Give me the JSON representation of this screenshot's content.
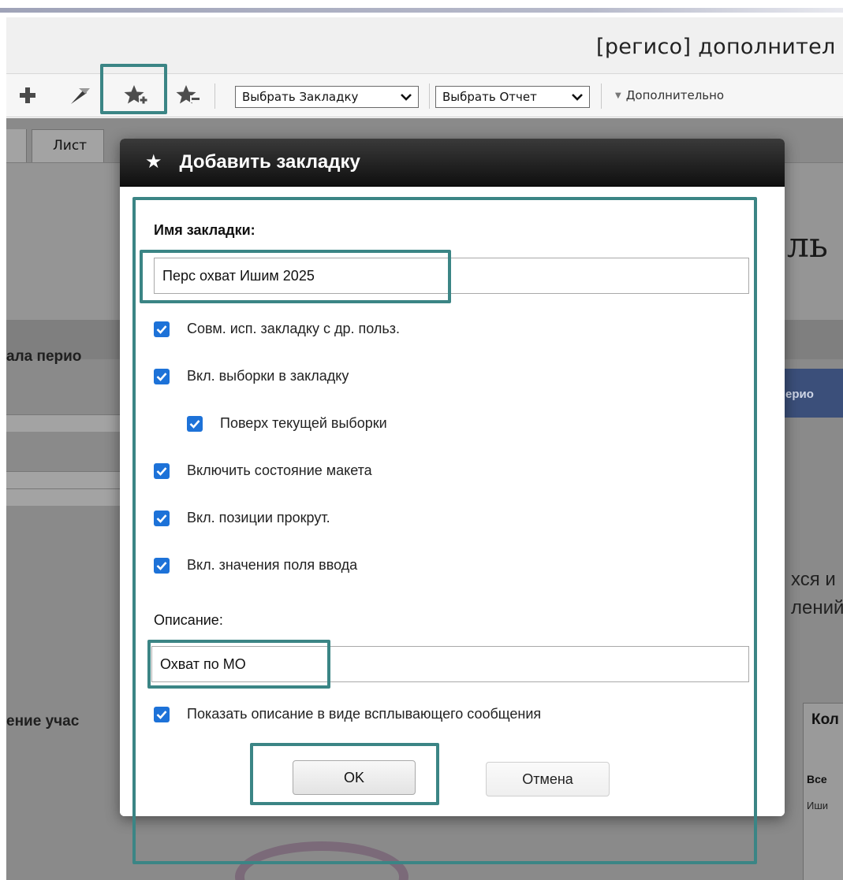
{
  "window": {
    "title": "[регисо] дополнител"
  },
  "toolbar": {
    "select_bookmark": "Выбрать Закладку",
    "select_report": "Выбрать Отчет",
    "more": "Дополнительно"
  },
  "background": {
    "tab_label": "Лист",
    "heading_fragment": "ль",
    "period_fragment": "ала перио",
    "button_fragment": "ерио",
    "text_fragment_1": "хся и",
    "text_fragment_2": "лений",
    "section_fragment": "ение учас",
    "card_title": "Кол",
    "card_row_1": "Все",
    "card_row_2": "Иши"
  },
  "dialog": {
    "title": "Добавить закладку",
    "name_label": "Имя закладки:",
    "name_value": "Перс охват Ишим 2025",
    "checkboxes": [
      {
        "label": "Совм. исп. закладку с др. польз.",
        "checked": true
      },
      {
        "label": "Вкл. выборки в закладку",
        "checked": true
      },
      {
        "label": "Поверх текущей выборки",
        "checked": true
      },
      {
        "label": "Включить состояние макета",
        "checked": true
      },
      {
        "label": "Вкл. позиции прокрут.",
        "checked": true
      },
      {
        "label": "Вкл. значения поля ввода",
        "checked": true
      }
    ],
    "description_label": "Описание:",
    "description_value": "Охват по МО",
    "tooltip_checkbox": {
      "label": "Показать описание в виде всплывающего сообщения",
      "checked": true
    },
    "ok_label": "OK",
    "cancel_label": "Отмена"
  },
  "colors": {
    "highlight": "#3b8585",
    "checkbox": "#1d72d8",
    "dialog_header": "#111111"
  }
}
